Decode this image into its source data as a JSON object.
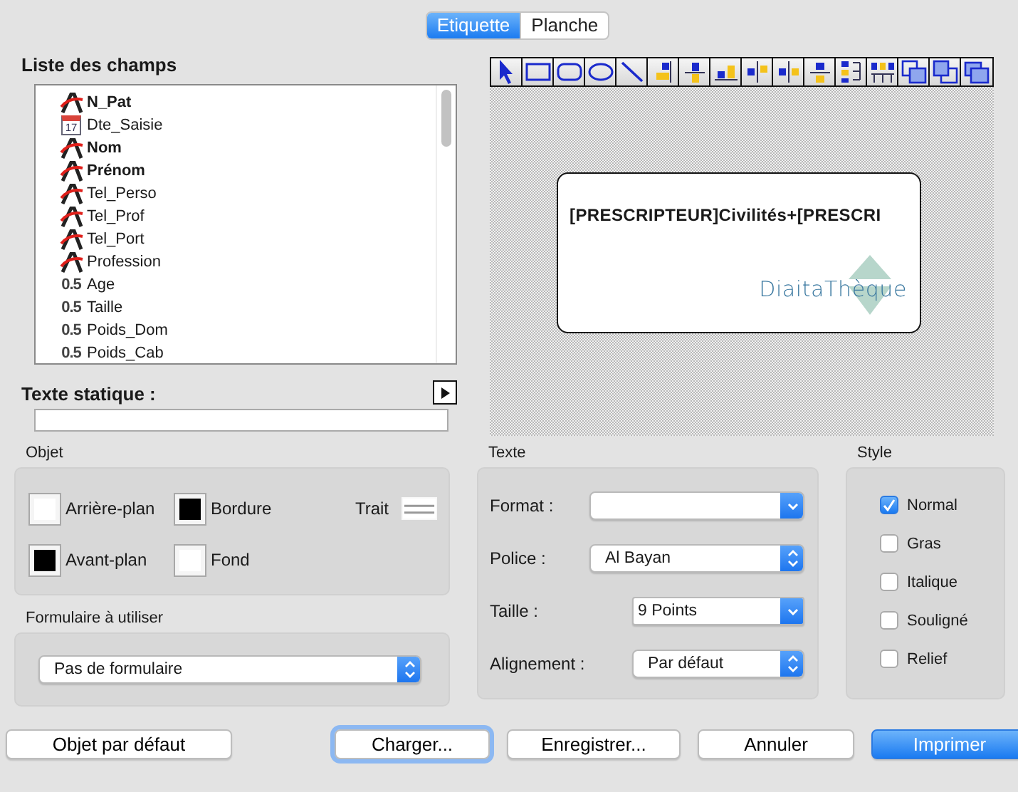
{
  "tabs": [
    {
      "label": "Etiquette",
      "selected": true
    },
    {
      "label": "Planche",
      "selected": false
    }
  ],
  "field_list": {
    "title": "Liste des champs",
    "items": [
      {
        "name": "N_Pat",
        "kind": "text",
        "bold": true
      },
      {
        "name": "Dte_Saisie",
        "kind": "date",
        "badge": "17",
        "bold": false
      },
      {
        "name": "Nom",
        "kind": "text",
        "bold": true
      },
      {
        "name": "Prénom",
        "kind": "text",
        "bold": true
      },
      {
        "name": "Tel_Perso",
        "kind": "text",
        "bold": false
      },
      {
        "name": "Tel_Prof",
        "kind": "text",
        "bold": false
      },
      {
        "name": "Tel_Port",
        "kind": "text",
        "bold": false
      },
      {
        "name": "Profession",
        "kind": "text",
        "bold": false
      },
      {
        "name": "Age",
        "kind": "number",
        "badge": "0.5",
        "bold": false
      },
      {
        "name": "Taille",
        "kind": "number",
        "badge": "0.5",
        "bold": false
      },
      {
        "name": "Poids_Dom",
        "kind": "number",
        "badge": "0.5",
        "bold": false
      },
      {
        "name": "Poids_Cab",
        "kind": "number",
        "badge": "0.5",
        "bold": false
      }
    ]
  },
  "static_text": {
    "label": "Texte statique :"
  },
  "canvas": {
    "label_text": "[PRESCRIPTEUR]Civilités+[PRESCRI",
    "logo": "DiaitaThèque"
  },
  "objet": {
    "title": "Objet",
    "swatches": [
      {
        "label": "Arrière-plan",
        "color": "#ffffff"
      },
      {
        "label": "Bordure",
        "color": "#000000"
      },
      {
        "label": "Avant-plan",
        "color": "#000000"
      },
      {
        "label": "Fond",
        "color": "#ffffff"
      }
    ],
    "line_label": "Trait"
  },
  "formulaire": {
    "title": "Formulaire à utiliser",
    "value": "Pas de formulaire"
  },
  "texte": {
    "title": "Texte",
    "rows": [
      {
        "label": "Format :",
        "kind": "dropdown"
      },
      {
        "label": "Police :",
        "kind": "popup",
        "value": "Al Bayan"
      },
      {
        "label": "Taille :",
        "kind": "combo",
        "value": "9 Points"
      },
      {
        "label": "Alignement :",
        "kind": "popup",
        "value": "Par défaut"
      }
    ]
  },
  "style": {
    "title": "Style",
    "options": [
      {
        "label": "Normal",
        "checked": true
      },
      {
        "label": "Gras",
        "checked": false
      },
      {
        "label": "Italique",
        "checked": false
      },
      {
        "label": "Souligné",
        "checked": false
      },
      {
        "label": "Relief",
        "checked": false
      }
    ]
  },
  "buttons": [
    {
      "label": "Objet par défaut",
      "kind": "normal"
    },
    {
      "label": "Charger...",
      "kind": "focused"
    },
    {
      "label": "Enregistrer...",
      "kind": "normal"
    },
    {
      "label": "Annuler",
      "kind": "normal"
    },
    {
      "label": "Imprimer",
      "kind": "default"
    }
  ]
}
